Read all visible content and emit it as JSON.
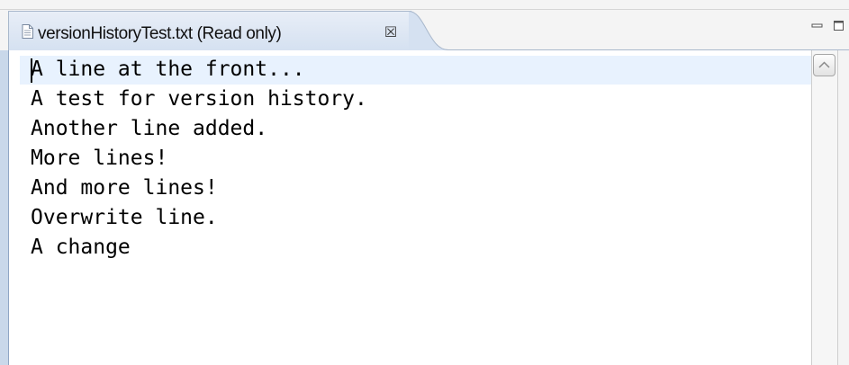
{
  "tab": {
    "title": "versionHistoryTest.txt (Read only)",
    "close_glyph": "☒",
    "icon": "text-file-icon"
  },
  "window_controls": {
    "minimize_icon": "minimize-icon",
    "maximize_icon": "maximize-icon"
  },
  "editor": {
    "lines": [
      "A line at the front...",
      "A test for version history.",
      "Another line added.",
      "More lines!",
      "And more lines!",
      "Overwrite line.",
      "A change"
    ]
  },
  "colors": {
    "current_line_highlight": "#e8f2fe",
    "tab_background": "#d5e1f1",
    "left_frame": "#c9d8ea"
  }
}
